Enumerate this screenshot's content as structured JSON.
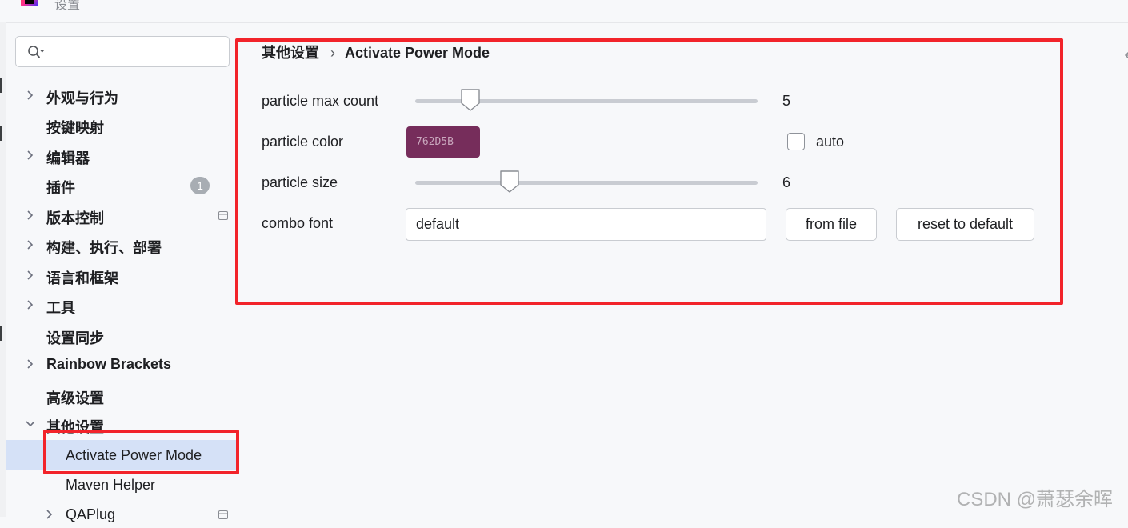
{
  "window": {
    "title": "设置",
    "logo_icon": "intellij-idea-logo"
  },
  "sidebar": {
    "search": {
      "value": "",
      "placeholder": "",
      "icon": "search-icon"
    },
    "items": [
      {
        "label": "外观与行为",
        "expandable": true
      },
      {
        "label": "按键映射",
        "expandable": false
      },
      {
        "label": "编辑器",
        "expandable": true
      },
      {
        "label": "插件",
        "expandable": false,
        "badge": "1"
      },
      {
        "label": "版本控制",
        "expandable": true,
        "icon": "database-icon"
      },
      {
        "label": "构建、执行、部署",
        "expandable": true
      },
      {
        "label": "语言和框架",
        "expandable": true
      },
      {
        "label": "工具",
        "expandable": true
      },
      {
        "label": "设置同步",
        "expandable": false
      },
      {
        "label": "Rainbow Brackets",
        "expandable": true
      },
      {
        "label": "高级设置",
        "expandable": false
      },
      {
        "label": "其他设置",
        "expandable": true,
        "expanded": true
      },
      {
        "label": "Activate Power Mode",
        "selected": true
      },
      {
        "label": "Maven Helper"
      },
      {
        "label": "QAPlug",
        "expandable": true,
        "icon": "database-icon"
      }
    ]
  },
  "content": {
    "breadcrumb": {
      "parent": "其他设置",
      "separator": "›",
      "current": "Activate Power Mode"
    },
    "particle_max_count": {
      "label": "particle max count",
      "value": "5",
      "level": 0.14
    },
    "particle_color": {
      "label": "particle color",
      "hex": "762D5B",
      "swatch": "#762d5b"
    },
    "auto": {
      "label": "auto",
      "checked": false
    },
    "particle_size": {
      "label": "particle size",
      "value": "6",
      "level": 0.26
    },
    "combo_font": {
      "label": "combo font",
      "value": "default"
    },
    "buttons": {
      "from_file": "from file",
      "reset": "reset to default"
    }
  },
  "watermark": "CSDN @萧瑟余晖",
  "colors": {
    "accent": "#d5e1f7",
    "highlight": "#f2232a"
  }
}
